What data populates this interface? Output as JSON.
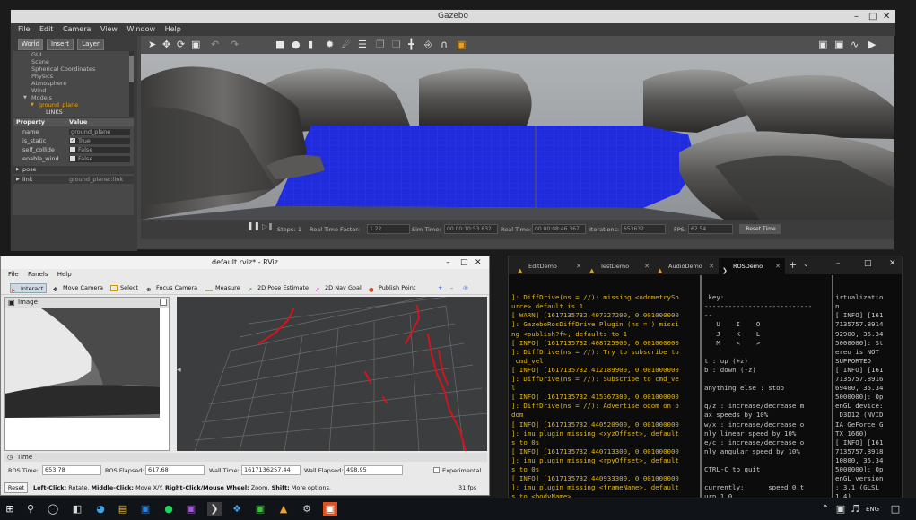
{
  "gazebo": {
    "title": "Gazebo",
    "menu": [
      "File",
      "Edit",
      "Camera",
      "View",
      "Window",
      "Help"
    ],
    "tabs": [
      "World",
      "Insert",
      "Layer"
    ],
    "tree": [
      "GUI",
      "Scene",
      "Spherical Coordinates",
      "Physics",
      "Atmosphere",
      "Wind",
      "Models",
      "ground_plane",
      "LINKS"
    ],
    "props_header": {
      "property": "Property",
      "value": "Value"
    },
    "props": [
      {
        "k": "name",
        "v": "ground_plane"
      },
      {
        "k": "is_static",
        "v": "True"
      },
      {
        "k": "self_collide",
        "v": "False"
      },
      {
        "k": "enable_wind",
        "v": "False"
      },
      {
        "k": "pose",
        "v": ""
      },
      {
        "k": "link",
        "v": "ground_plane::link"
      }
    ],
    "status": {
      "steps_label": "Steps:",
      "steps_value": "1",
      "rtf_label": "Real Time Factor:",
      "rtf_value": "1.22",
      "sim_label": "Sim Time:",
      "sim_value": "00 00:10:53.632",
      "real_label": "Real Time:",
      "real_value": "00 00:08:46.367",
      "iter_label": "Iterations:",
      "iter_value": "653632",
      "fps_label": "FPS:",
      "fps_value": "62.54",
      "reset_label": "Reset Time"
    }
  },
  "rviz": {
    "title": "default.rviz* - RViz",
    "menu": [
      "File",
      "Panels",
      "Help"
    ],
    "tools": [
      "Interact",
      "Move Camera",
      "Select",
      "Focus Camera",
      "Measure",
      "2D Pose Estimate",
      "2D Nav Goal",
      "Publish Point"
    ],
    "image_panel_title": "Image",
    "time_panel_title": "Time",
    "time": {
      "ros_time_label": "ROS Time:",
      "ros_time": "653.78",
      "ros_elapsed_label": "ROS Elapsed:",
      "ros_elapsed": "617.68",
      "wall_time_label": "Wall Time:",
      "wall_time": "1617136257.44",
      "wall_elapsed_label": "Wall Elapsed:",
      "wall_elapsed": "498.95",
      "experimental": "Experimental"
    },
    "reset_label": "Reset",
    "hint_left_b": "Left-Click:",
    "hint_left": " Rotate. ",
    "hint_mid_b": "Middle-Click:",
    "hint_mid": " Move X/Y. ",
    "hint_right_b": "Right-Click/Mouse Wheel:",
    "hint_right": " Zoom. ",
    "hint_shift_b": "Shift:",
    "hint_shift": " More options.",
    "fps": "31 fps"
  },
  "terminal": {
    "tabs": [
      "EditDemo",
      "TestDemo",
      "AudioDemo",
      "ROSDemo"
    ],
    "pane1": "]: DiffDrive(ns = //): missing <odometrySo\nurce> default is 1\n[ WARN] [1617135732.407327200, 0.001000000\n]: GazeboRosDiffDrive Plugin (ns = ) missi\nng <publish?f>, defaults to 1\n[ INFO] [1617135732.408725900, 0.001000000\n]: DiffDrive(ns = //): Try to subscribe to\n cmd_vel\n[ INFO] [1617135732.412189900, 0.001000000\n]: DiffDrive(ns = //): Subscribe to cmd_ve\nl\n[ INFO] [1617135732.415367300, 0.001000000\n]: DiffDrive(ns = //): Advertise odom on o\ndom\n[ INFO] [1617135732.440520900, 0.001000000\n]: imu plugin missing <xyzOffset>, default\ns to 0s\n[ INFO] [1617135732.440713300, 0.001000000\n]: imu plugin missing <rpyOffset>, default\ns to 0s\n[ INFO] [1617135732.440933300, 0.001000000\n]: imu plugin missing <frameName>, default\ns to <bodyName>",
    "pane2": " key:\n---------------------------\n--\n   U    I    O\n   J    K    L\n   M    <    >\n\nt : up (+z)\nb : down (-z)\n\nanything else : stop\n\nq/z : increase/decrease m\nax speeds by 10%\nw/x : increase/decrease o\nnly linear speed by 10%\ne/c : increase/decrease o\nnly angular speed by 10%\n\nCTRL-C to quit\n\ncurrently:      speed 0.t\nurn 1.0",
    "pane3": "irtualizatio\nn\n[ INFO] [161\n7135757.8914\n92900, 35.34\n5000000]: St\nereo is NOT\nSUPPORTED\n[ INFO] [161\n7135757.8916\n69400, 35.34\n5000000]: Op\nenGL device:\n D3D12 (NVID\nIA GeForce G\nTX 1660)\n[ INFO] [161\n7135757.8918\n10800, 35.34\n5000000]: Op\nenGL version\n: 3.1 (GLSL\n1.4)."
  },
  "taskbar": {
    "lang": "ENG"
  },
  "colors": {
    "water": "#1f2bdc",
    "scan": "#e0141e",
    "warn_yellow": "#e5b510"
  }
}
